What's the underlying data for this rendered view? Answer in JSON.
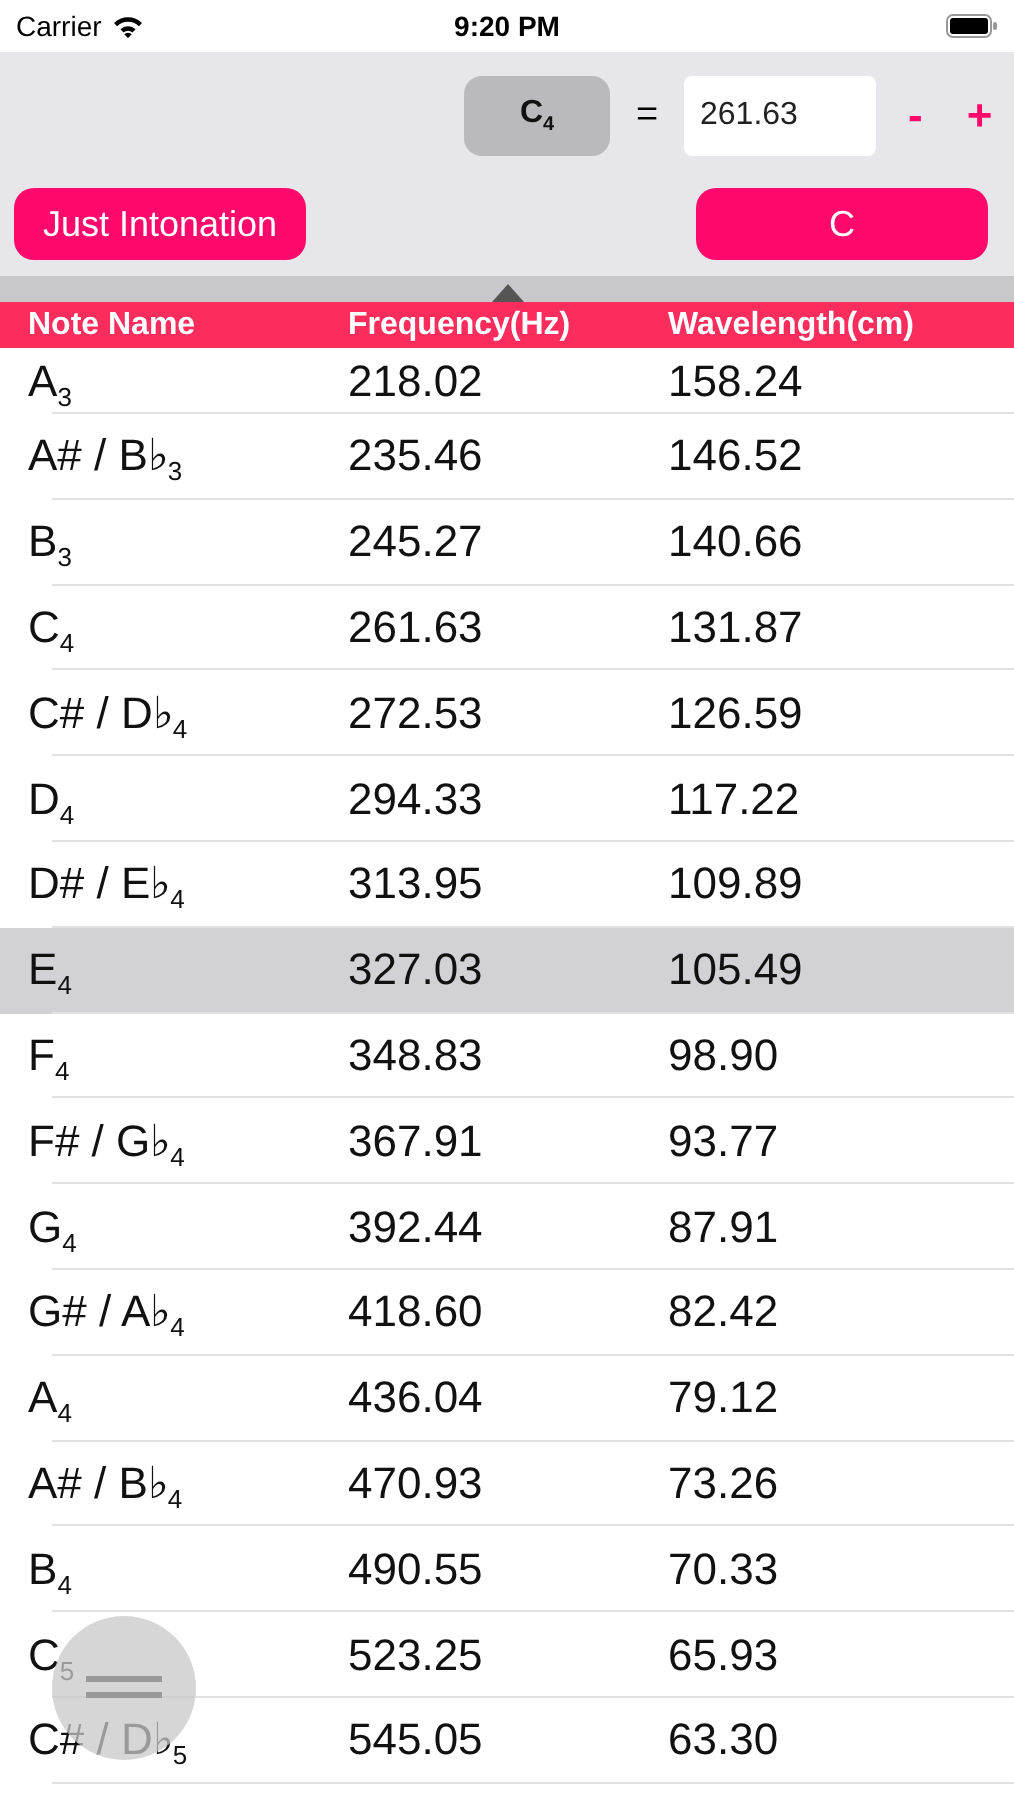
{
  "status_bar": {
    "carrier": "Carrier",
    "time": "9:20 PM"
  },
  "reference": {
    "note": "C$_{4}$",
    "equals": "=",
    "frequency": "261.63",
    "decrement": "-",
    "increment": "+"
  },
  "tuning_button": "Just Intonation",
  "key_button": "C",
  "table": {
    "columns": [
      "Note Name",
      "Frequency(Hz)",
      "Wavelength(cm)"
    ],
    "rows": [
      {
        "note": "A$_{3}$",
        "frequency": "218.02",
        "wavelength": "158.24",
        "selected": false
      },
      {
        "note": "A# / B♭$_{3}$",
        "frequency": "235.46",
        "wavelength": "146.52",
        "selected": false
      },
      {
        "note": "B$_{3}$",
        "frequency": "245.27",
        "wavelength": "140.66",
        "selected": false
      },
      {
        "note": "C$_{4}$",
        "frequency": "261.63",
        "wavelength": "131.87",
        "selected": false
      },
      {
        "note": "C# / D♭$_{4}$",
        "frequency": "272.53",
        "wavelength": "126.59",
        "selected": false
      },
      {
        "note": "D$_{4}$",
        "frequency": "294.33",
        "wavelength": "117.22",
        "selected": false
      },
      {
        "note": "D# / E♭$_{4}$",
        "frequency": "313.95",
        "wavelength": "109.89",
        "selected": false
      },
      {
        "note": "E$_{4}$",
        "frequency": "327.03",
        "wavelength": "105.49",
        "selected": true
      },
      {
        "note": "F$_{4}$",
        "frequency": "348.83",
        "wavelength": "98.90",
        "selected": false
      },
      {
        "note": "F# / G♭$_{4}$",
        "frequency": "367.91",
        "wavelength": "93.77",
        "selected": false
      },
      {
        "note": "G$_{4}$",
        "frequency": "392.44",
        "wavelength": "87.91",
        "selected": false
      },
      {
        "note": "G# / A♭$_{4}$",
        "frequency": "418.60",
        "wavelength": "82.42",
        "selected": false
      },
      {
        "note": "A$_{4}$",
        "frequency": "436.04",
        "wavelength": "79.12",
        "selected": false
      },
      {
        "note": "A# / B♭$_{4}$",
        "frequency": "470.93",
        "wavelength": "73.26",
        "selected": false
      },
      {
        "note": "B$_{4}$",
        "frequency": "490.55",
        "wavelength": "70.33",
        "selected": false
      },
      {
        "note": "C$_{5}$",
        "frequency": "523.25",
        "wavelength": "65.93",
        "selected": false
      },
      {
        "note": "C# / D♭$_{5}$",
        "frequency": "545.05",
        "wavelength": "63.30",
        "selected": false
      }
    ]
  }
}
